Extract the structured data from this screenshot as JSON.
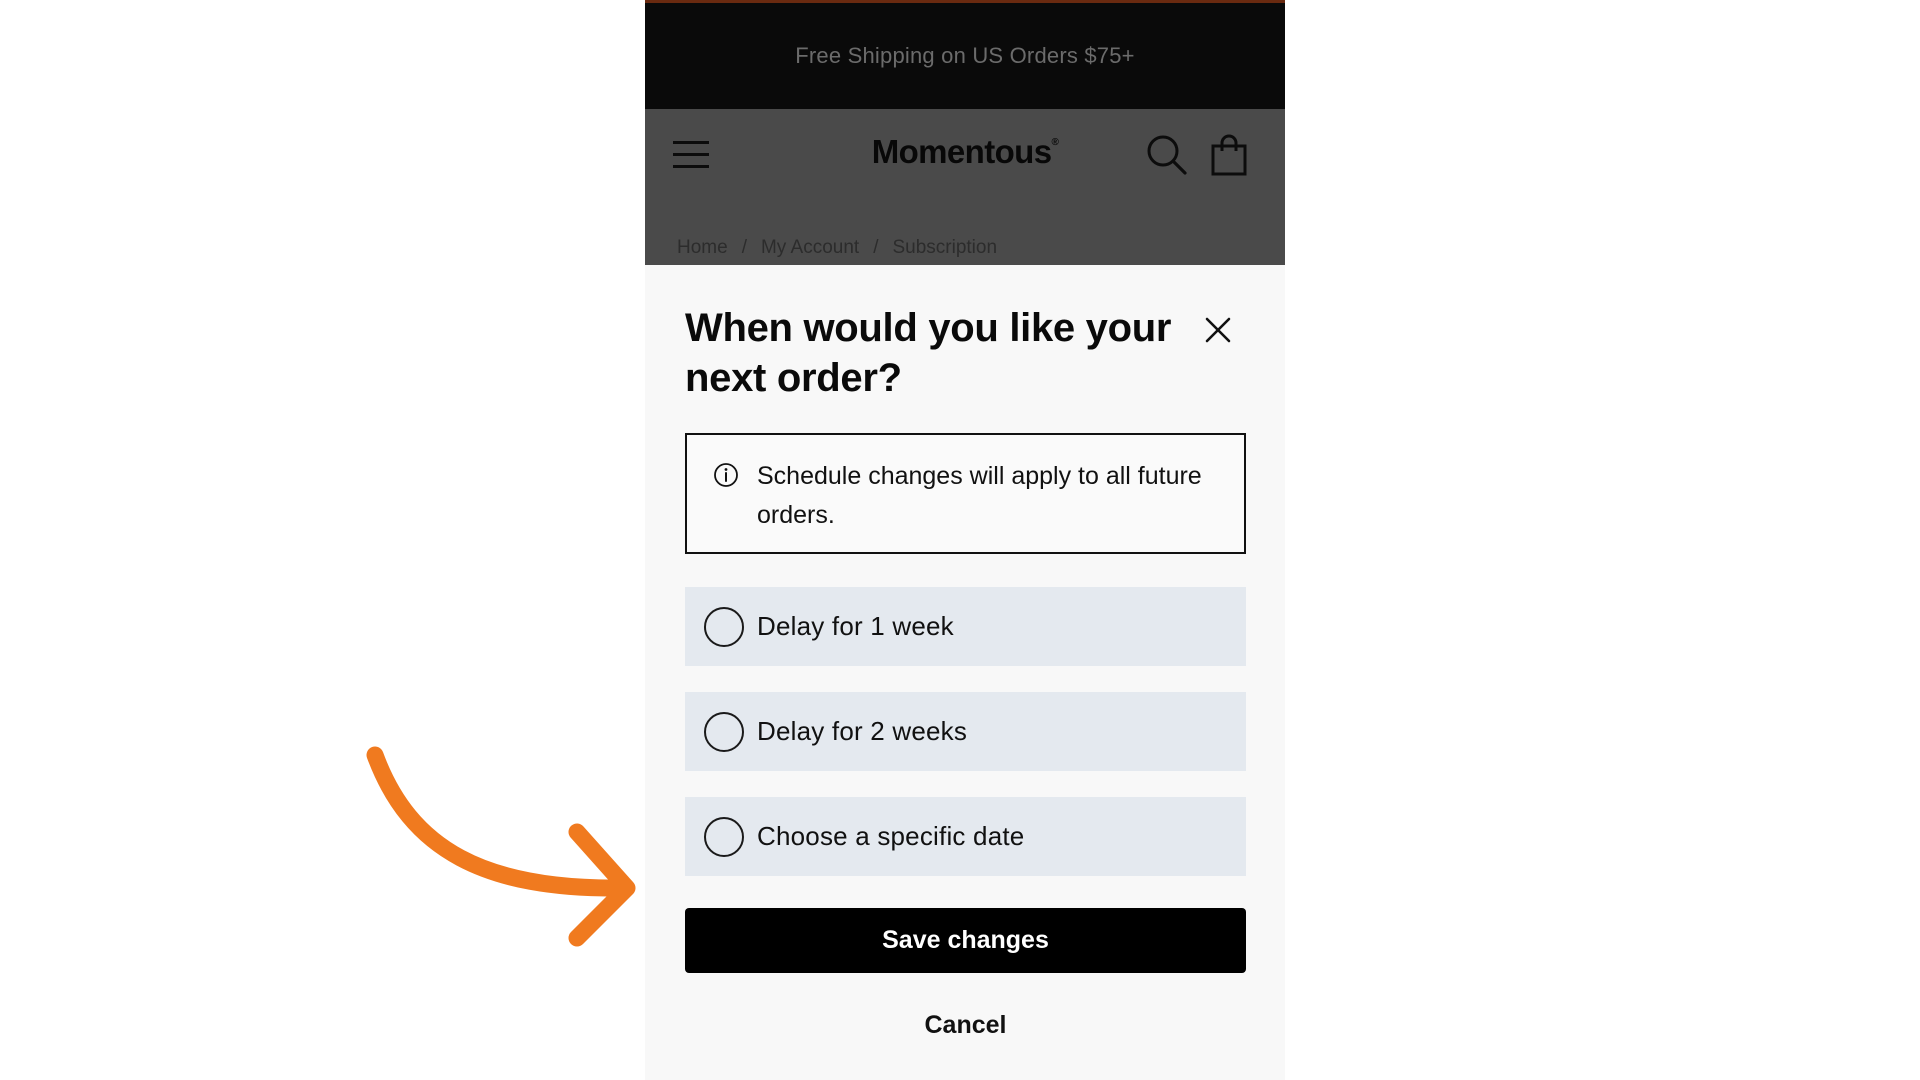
{
  "promo": {
    "text": "Free Shipping on US Orders $75+"
  },
  "header": {
    "logo": "Momentous",
    "logo_mark": "®",
    "icons": {
      "menu": "hamburger-menu-icon",
      "search": "search-icon",
      "cart": "shopping-bag-icon"
    }
  },
  "breadcrumb": {
    "items": [
      "Home",
      "My Account",
      "Subscription"
    ],
    "separator": "/"
  },
  "modal": {
    "title": "When would you like your next order?",
    "info_text": "Schedule changes will apply to all future orders.",
    "options": [
      {
        "label": "Delay for 1 week",
        "selected": false
      },
      {
        "label": "Delay for 2 weeks",
        "selected": false
      },
      {
        "label": "Choose a specific date",
        "selected": false
      }
    ],
    "save_label": "Save changes",
    "cancel_label": "Cancel"
  },
  "colors": {
    "accent_arrow": "#f07a1f",
    "promo_bg": "#0a0a0a",
    "header_overlay": "#4a4a4a",
    "option_bg": "#e4e9ef",
    "primary_button": "#000000"
  }
}
